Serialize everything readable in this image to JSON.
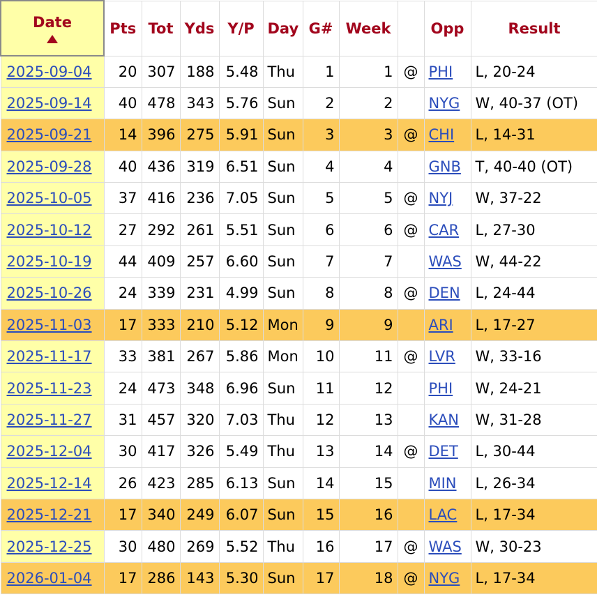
{
  "headers": {
    "date": "Date",
    "pts": "Pts",
    "tot": "Tot",
    "yds": "Yds",
    "yp": "Y/P",
    "day": "Day",
    "g": "G#",
    "week": "Week",
    "at": "",
    "opp": "Opp",
    "result": "Result"
  },
  "rows": [
    {
      "date": "2025-09-04",
      "pts": "20",
      "tot": "307",
      "yds": "188",
      "yp": "5.48",
      "day": "Thu",
      "g": "1",
      "week": "1",
      "at": "@",
      "opp": "PHI",
      "result": "L, 20-24",
      "highlight": false
    },
    {
      "date": "2025-09-14",
      "pts": "40",
      "tot": "478",
      "yds": "343",
      "yp": "5.76",
      "day": "Sun",
      "g": "2",
      "week": "2",
      "at": "",
      "opp": "NYG",
      "result": "W, 40-37 (OT)",
      "highlight": false
    },
    {
      "date": "2025-09-21",
      "pts": "14",
      "tot": "396",
      "yds": "275",
      "yp": "5.91",
      "day": "Sun",
      "g": "3",
      "week": "3",
      "at": "@",
      "opp": "CHI",
      "result": "L, 14-31",
      "highlight": true
    },
    {
      "date": "2025-09-28",
      "pts": "40",
      "tot": "436",
      "yds": "319",
      "yp": "6.51",
      "day": "Sun",
      "g": "4",
      "week": "4",
      "at": "",
      "opp": "GNB",
      "result": "T, 40-40 (OT)",
      "highlight": false
    },
    {
      "date": "2025-10-05",
      "pts": "37",
      "tot": "416",
      "yds": "236",
      "yp": "7.05",
      "day": "Sun",
      "g": "5",
      "week": "5",
      "at": "@",
      "opp": "NYJ",
      "result": "W, 37-22",
      "highlight": false
    },
    {
      "date": "2025-10-12",
      "pts": "27",
      "tot": "292",
      "yds": "261",
      "yp": "5.51",
      "day": "Sun",
      "g": "6",
      "week": "6",
      "at": "@",
      "opp": "CAR",
      "result": "L, 27-30",
      "highlight": false
    },
    {
      "date": "2025-10-19",
      "pts": "44",
      "tot": "409",
      "yds": "257",
      "yp": "6.60",
      "day": "Sun",
      "g": "7",
      "week": "7",
      "at": "",
      "opp": "WAS",
      "result": "W, 44-22",
      "highlight": false
    },
    {
      "date": "2025-10-26",
      "pts": "24",
      "tot": "339",
      "yds": "231",
      "yp": "4.99",
      "day": "Sun",
      "g": "8",
      "week": "8",
      "at": "@",
      "opp": "DEN",
      "result": "L, 24-44",
      "highlight": false
    },
    {
      "date": "2025-11-03",
      "pts": "17",
      "tot": "333",
      "yds": "210",
      "yp": "5.12",
      "day": "Mon",
      "g": "9",
      "week": "9",
      "at": "",
      "opp": "ARI",
      "result": "L, 17-27",
      "highlight": true
    },
    {
      "date": "2025-11-17",
      "pts": "33",
      "tot": "381",
      "yds": "267",
      "yp": "5.86",
      "day": "Mon",
      "g": "10",
      "week": "11",
      "at": "@",
      "opp": "LVR",
      "result": "W, 33-16",
      "highlight": false
    },
    {
      "date": "2025-11-23",
      "pts": "24",
      "tot": "473",
      "yds": "348",
      "yp": "6.96",
      "day": "Sun",
      "g": "11",
      "week": "12",
      "at": "",
      "opp": "PHI",
      "result": "W, 24-21",
      "highlight": false
    },
    {
      "date": "2025-11-27",
      "pts": "31",
      "tot": "457",
      "yds": "320",
      "yp": "7.03",
      "day": "Thu",
      "g": "12",
      "week": "13",
      "at": "",
      "opp": "KAN",
      "result": "W, 31-28",
      "highlight": false
    },
    {
      "date": "2025-12-04",
      "pts": "30",
      "tot": "417",
      "yds": "326",
      "yp": "5.49",
      "day": "Thu",
      "g": "13",
      "week": "14",
      "at": "@",
      "opp": "DET",
      "result": "L, 30-44",
      "highlight": false
    },
    {
      "date": "2025-12-14",
      "pts": "26",
      "tot": "423",
      "yds": "285",
      "yp": "6.13",
      "day": "Sun",
      "g": "14",
      "week": "15",
      "at": "",
      "opp": "MIN",
      "result": "L, 26-34",
      "highlight": false
    },
    {
      "date": "2025-12-21",
      "pts": "17",
      "tot": "340",
      "yds": "249",
      "yp": "6.07",
      "day": "Sun",
      "g": "15",
      "week": "16",
      "at": "",
      "opp": "LAC",
      "result": "L, 17-34",
      "highlight": true
    },
    {
      "date": "2025-12-25",
      "pts": "30",
      "tot": "480",
      "yds": "269",
      "yp": "5.52",
      "day": "Thu",
      "g": "16",
      "week": "17",
      "at": "@",
      "opp": "WAS",
      "result": "W, 30-23",
      "highlight": false
    },
    {
      "date": "2026-01-04",
      "pts": "17",
      "tot": "286",
      "yds": "143",
      "yp": "5.30",
      "day": "Sun",
      "g": "17",
      "week": "18",
      "at": "@",
      "opp": "NYG",
      "result": "L, 17-34",
      "highlight": true
    }
  ],
  "colors": {
    "header_text": "#a2061d",
    "date_column_bg": "#ffffa8",
    "highlight_row_bg": "#fcca5c",
    "link": "#2b4dbb",
    "grid": "#dcdcdc"
  },
  "sort": {
    "column": "date",
    "direction": "ascending",
    "icon": "sort-up-triangle-icon"
  }
}
